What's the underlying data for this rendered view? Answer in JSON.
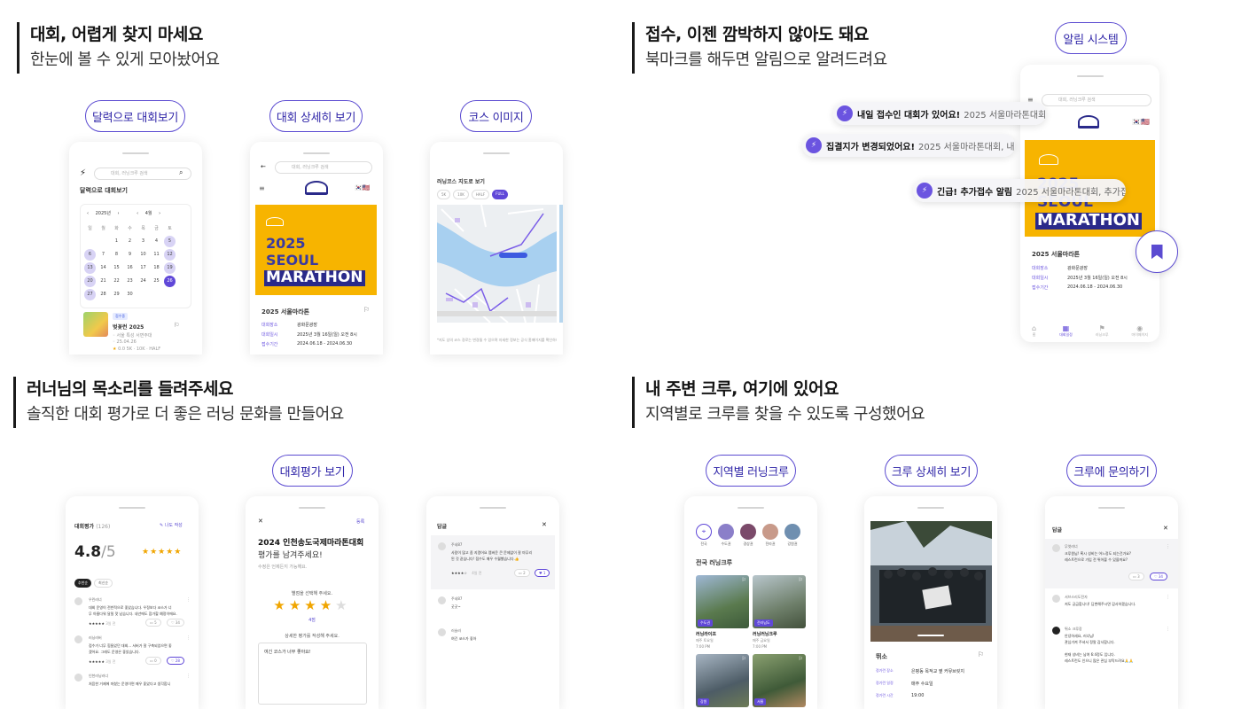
{
  "q1": {
    "title": "대회, 어렵게 찾지 마세요",
    "subtitle": "한눈에  볼 수 있게 모아놨어요",
    "pills": [
      "달력으로 대회보기",
      "대회 상세히 보기",
      "코스 이미지"
    ]
  },
  "q2": {
    "title": "접수, 이젠 깜박하지 않아도 돼요",
    "subtitle": "북마크를 해두면 알림으로 알려드려요",
    "pill": "알림 시스템",
    "toasts": [
      {
        "bold": "내일 접수인 대회가 있어요!",
        "rest": "2025 서울마라톤대회,..."
      },
      {
        "bold": "집결지가 변경되었어요!",
        "rest": "2025 서울마라톤대회, 내..."
      },
      {
        "bold": "긴급! 추가접수 알림",
        "rest": "2025 서울마라톤대회, 추가접..."
      }
    ]
  },
  "q3": {
    "title": "러너님의 목소리를 들려주세요",
    "subtitle": "솔직한 대회 평가로 더 좋은 러닝 문화를 만들어요",
    "pill": "대회평가 보기"
  },
  "q4": {
    "title": "내 주변 크루, 여기에 있어요",
    "subtitle": "지역별로 크루를 찾을 수 있도록 구성했어요",
    "pills": [
      "지역별 러닝크루",
      "크루 상세히 보기",
      "크루에 문의하기"
    ]
  },
  "common": {
    "search_placeholder": "대회, 러닝크루 검색",
    "poster_year": "2025",
    "poster_city": "SEOUL",
    "poster_event": "MARATHON",
    "race_name": "2025 서울마라톤",
    "detail_rows": [
      {
        "label": "대회장소",
        "value": "광화문광장"
      },
      {
        "label": "대회일시",
        "value": "2025년 3월 16일(일) 오전 8시"
      },
      {
        "label": "접수기간",
        "value": "2024.06.18 - 2024.06.30"
      }
    ]
  },
  "calendar": {
    "header": "달력으로 대회보기",
    "year": "2025년",
    "month": "4월",
    "weekdays": [
      "일",
      "월",
      "화",
      "수",
      "목",
      "금",
      "토"
    ],
    "weeks": [
      [
        "",
        "",
        "1",
        "2",
        "3",
        "4",
        "5"
      ],
      [
        "6",
        "7",
        "8",
        "9",
        "10",
        "11",
        "12"
      ],
      [
        "13",
        "14",
        "15",
        "16",
        "17",
        "18",
        "19"
      ],
      [
        "20",
        "21",
        "22",
        "23",
        "24",
        "25",
        "26"
      ],
      [
        "27",
        "28",
        "29",
        "30",
        "",
        "",
        ""
      ]
    ],
    "highlighted": [
      "5",
      "6",
      "12",
      "13",
      "19",
      "20",
      "26",
      "27"
    ],
    "selected": "26",
    "event": {
      "tag": "접수중",
      "name": "벚꽃런 2025",
      "place": "서울 특성 서면주대",
      "date": "25.04.26",
      "rating": "0.0",
      "courses": "5K · 10K · HALF"
    }
  },
  "course": {
    "header": "러닝코스 지도로 보기",
    "chips": [
      "5K",
      "10K",
      "HALF",
      "FULL"
    ],
    "active_chip": "FULL",
    "note": "*지도 상의 코스 경로는 변경될 수 있으며 자세한 정보는 공식 홈페이지를 확인하세요."
  },
  "notif_phone": {
    "tabs": [
      "홈",
      "대회일정",
      "러닝크루",
      "마이페이지"
    ]
  },
  "reviews": {
    "header": "대회평가",
    "count": "(126)",
    "write": "나도 작성",
    "score": "4.8",
    "out_of": "/5",
    "sort": [
      "추천순",
      "최신순"
    ],
    "items": [
      {
        "user": "우린러너",
        "text1": "대회 운영이 전반적으로 좋았습니다. 우정보다 코스가 너",
        "text2": "무 아름다워 달릴 맛 났습니다. 내년에도 참가할 예정이에요.",
        "date": "3일 전",
        "comments": "5",
        "likes": "34"
      },
      {
        "user": "러닝러버",
        "text1": "접수가 너무 힘들었던 대회... 서버가 잘 구축되었으면 좋",
        "text2": "겠어요. 그래도 운영은 좋았습니다.",
        "date": "3일 전",
        "comments": "0",
        "likes": "28"
      },
      {
        "user": "인천러닝러너",
        "text1": "처음한 거제에 마쳤는 운영이면 매우 좋았다고 생각합니",
        "text2": "",
        "date": "",
        "comments": "",
        "likes": ""
      }
    ]
  },
  "write_review": {
    "close": "✕",
    "submit": "등록",
    "title": "2024 인천송도국제마라톤대회",
    "subtitle": "평가를 남겨주세요!",
    "edit_note": "수정은 언제든지 가능해요.",
    "ask": "별점을 선택해 주세요.",
    "value": "4점",
    "detail_ask": "상세한 평가를 작성해 주세요.",
    "text": "여긴 코스가 너무 좋아요!"
  },
  "replies": {
    "header": "답글",
    "items": [
      {
        "user": "주네87",
        "text1": "사람이 많고 좀 지켰어요 멤버운 큰 문제없이 잘 마무리",
        "text2": "된 것 같습니다! 접수도 매우 수월했습니다.👍",
        "meta": "4일 전",
        "comments": "2",
        "likes": "1"
      },
      {
        "user": "주네87",
        "text1": "굿굿~",
        "text2": "",
        "meta": "",
        "comments": "",
        "likes": ""
      },
      {
        "user": "러슬러",
        "text1": "여긴 코스가 좋아",
        "text2": "",
        "meta": "",
        "comments": "",
        "likes": ""
      }
    ]
  },
  "crews_list": {
    "regions": [
      "전국",
      "수도권",
      "경상권",
      "전라권",
      "강원권"
    ],
    "header": "전국 러닝크루",
    "crews": [
      {
        "tag": "수도권",
        "name": "러닝라이프",
        "day": "매주 토요일",
        "time": "7:00 PM"
      },
      {
        "tag": "전라남도",
        "name": "러닝러닝크루",
        "day": "매주 금요일",
        "time": "7:00 PM"
      },
      {
        "tag": "강원",
        "name": "",
        "day": "",
        "time": ""
      },
      {
        "tag": "서울",
        "name": "",
        "day": "",
        "time": ""
      }
    ]
  },
  "crew_detail": {
    "name": "뛰소",
    "rows": [
      {
        "label": "정기런 장소",
        "value": "은평동 목적교 옆 커뮤브릿지"
      },
      {
        "label": "정기런 일정",
        "value": "매주 수요일"
      },
      {
        "label": "정기런 시간",
        "value": "19:00"
      }
    ]
  },
  "crew_qna": {
    "header": "답글",
    "items": [
      {
        "user": "무엇러너",
        "text1": "크루원님! 혹시 성비는 어느정도 되는건가요?",
        "text2": "레스트런으로 가입 전 뛰어볼 수 있을까요?",
        "comments": "3",
        "likes": "34"
      },
      {
        "user": "서브스리도전자",
        "text1": "저도 궁금합니다! 답변해주시면 감사하겠습니다.",
        "text2": ""
      },
      {
        "user": "뛰소 크루장",
        "text1": "안녕하세요, 러너님!",
        "text2": "관심가져 주셔서 정말 감사합니다."
      }
    ],
    "extra1": "현재 성비는 남여 6:4정도 입니다.",
    "extra2": "레스트런도 인으니 많은 관심 부탁드려요🙏🙏"
  }
}
